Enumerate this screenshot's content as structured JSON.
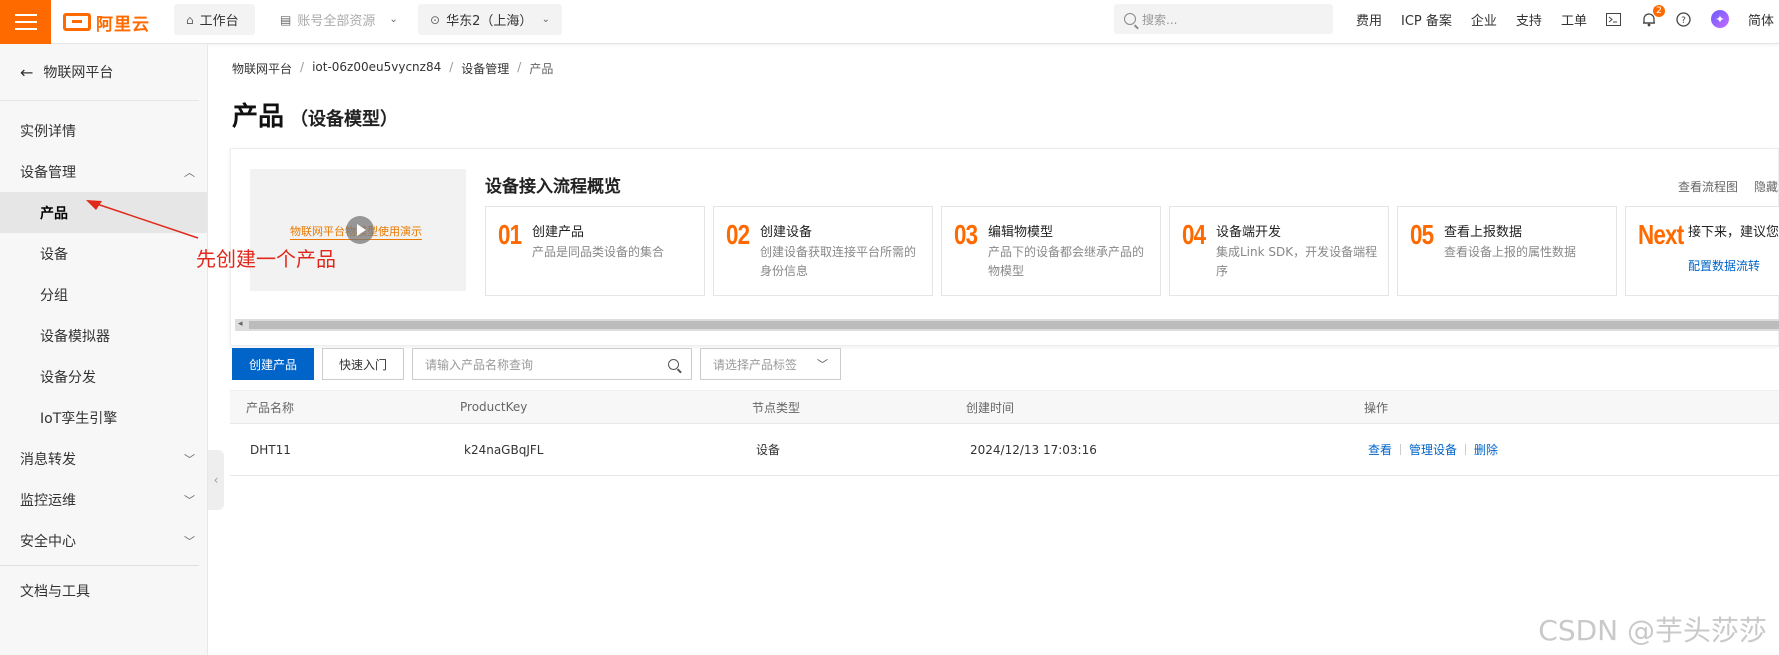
{
  "topbar": {
    "logo_text": "阿里云",
    "workspace": "工作台",
    "resources": "账号全部资源",
    "region": "华东2（上海）",
    "search_placeholder": "搜索...",
    "links": [
      "费用",
      "ICP 备案",
      "企业",
      "支持",
      "工单"
    ],
    "notification_count": "2",
    "language": "简体"
  },
  "sidebar": {
    "back_label": "物联网平台",
    "items": [
      {
        "label": "实例详情"
      },
      {
        "label": "设备管理"
      },
      {
        "label": "产品"
      },
      {
        "label": "设备"
      },
      {
        "label": "分组"
      },
      {
        "label": "设备模拟器"
      },
      {
        "label": "设备分发"
      },
      {
        "label": "IoT孪生引擎"
      },
      {
        "label": "消息转发"
      },
      {
        "label": "监控运维"
      },
      {
        "label": "安全中心"
      },
      {
        "label": "文档与工具"
      }
    ]
  },
  "annotation": {
    "text": "先创建一个产品",
    "color": "#e0291b"
  },
  "breadcrumb": [
    "物联网平台",
    "iot-06z00eu5vycnz84",
    "设备管理",
    "产品"
  ],
  "page_title": {
    "main": "产品",
    "sub": "（设备模型）"
  },
  "flow": {
    "video_title": "物联网平台物模型使用演示",
    "title": "设备接入流程概览",
    "view_diagram": "查看流程图",
    "hide": "隐藏",
    "steps": [
      {
        "num": "01",
        "title": "创建产品",
        "desc": "产品是同品类设备的集合"
      },
      {
        "num": "02",
        "title": "创建设备",
        "desc": "创建设备获取连接平台所需的身份信息"
      },
      {
        "num": "03",
        "title": "编辑物模型",
        "desc": "产品下的设备都会继承产品的物模型"
      },
      {
        "num": "04",
        "title": "设备端开发",
        "desc": "集成Link SDK，开发设备端程序"
      },
      {
        "num": "05",
        "title": "查看上报数据",
        "desc": "查看设备上报的属性数据"
      },
      {
        "num": "Next",
        "title": "接下来，建议您",
        "link": "配置数据流转"
      }
    ]
  },
  "toolbar": {
    "create_label": "创建产品",
    "quickstart_label": "快速入门",
    "search_placeholder": "请输入产品名称查询",
    "tag_placeholder": "请选择产品标签"
  },
  "table": {
    "headers": [
      "产品名称",
      "ProductKey",
      "节点类型",
      "创建时间",
      "操作"
    ],
    "rows": [
      {
        "name": "DHT11",
        "product_key": "k24naGBqJFL",
        "node_type": "设备",
        "created": "2024/12/13 17:03:16",
        "actions": [
          "查看",
          "管理设备",
          "删除"
        ]
      }
    ]
  },
  "watermark": "CSDN @芋头莎莎",
  "colors": {
    "brand": "#ff6a00",
    "primary": "#0064c8"
  }
}
